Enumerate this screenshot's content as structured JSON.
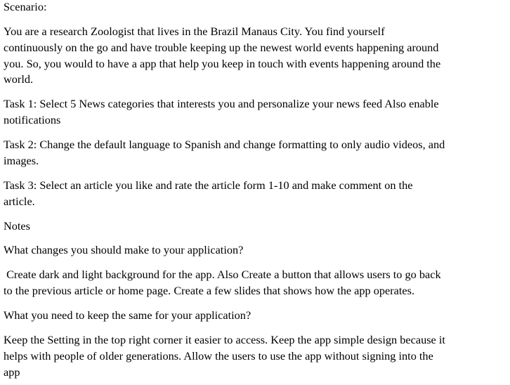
{
  "document": {
    "heading": "Scenario:",
    "scenario": [
      "You are a research Zoologist that lives in the Brazil Manaus City. You find yourself",
      "continuously on the go and have trouble keeping up the newest world events happening around",
      "you. So, you would to have a app that help you keep in touch with events happening around the",
      "world."
    ],
    "task1": [
      "Task 1: Select 5 News categories that interests you and personalize your news feed Also enable",
      "notifications"
    ],
    "task2": [
      "Task 2:  Change the default language to Spanish and change formatting to only audio videos, and",
      "images."
    ],
    "task3": [
      "Task 3:  Select an article you like and rate the article form 1-10 and make comment on the",
      "article."
    ],
    "notes_label": "Notes",
    "question1": "What changes you should make to your application?",
    "answer1": [
      " Create dark and light background for the app. Also Create a button that allows users to go back",
      "to the previous article or home page. Create a few slides that shows how the app operates."
    ],
    "question2": "What you need to keep the same for your application?",
    "answer2": [
      "Keep the Setting in the top right corner it easier to access. Keep the app simple design because it",
      "helps with people of older generations. Allow the users to use the app without signing into the",
      "app"
    ]
  }
}
